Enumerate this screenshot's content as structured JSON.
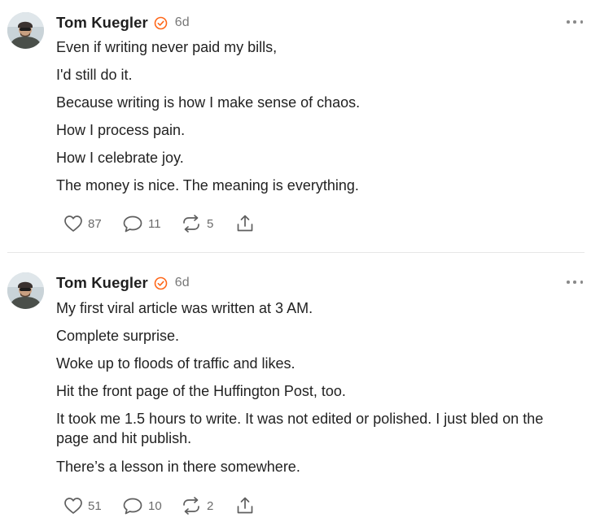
{
  "posts": [
    {
      "author": "Tom Kuegler",
      "time": "6d",
      "badge_icon": "verified-check-icon",
      "badge_color": "#ff6719",
      "lines": [
        "Even if writing never paid my bills,",
        "I'd still do it.",
        "Because writing is how I make sense of chaos.",
        "How I process pain.",
        "How I celebrate joy.",
        "The money is nice. The meaning is everything."
      ],
      "likes": "87",
      "comments": "11",
      "restacks": "5"
    },
    {
      "author": "Tom Kuegler",
      "time": "6d",
      "badge_icon": "verified-check-icon",
      "badge_color": "#ff6719",
      "lines": [
        "My first viral article was written at 3 AM.",
        "Complete surprise.",
        "Woke up to floods of traffic and likes.",
        "Hit the front page of the Huffington Post, too.",
        "It took me 1.5 hours to write. It was not edited or polished. I just bled on the page and hit publish.",
        "There’s a lesson in there somewhere."
      ],
      "likes": "51",
      "comments": "10",
      "restacks": "2"
    }
  ],
  "icons": {
    "like": "heart-icon",
    "comment": "comment-bubble-icon",
    "restack": "restack-arrows-icon",
    "share": "share-upload-icon",
    "more": "more-dots-icon"
  }
}
